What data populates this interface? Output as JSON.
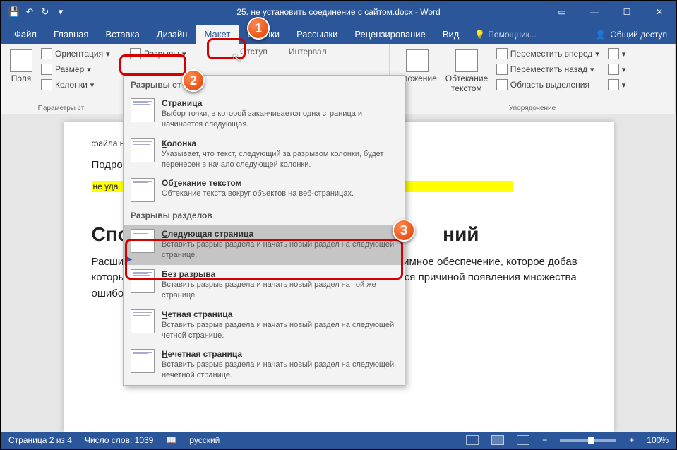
{
  "title": "25. не   установить соединение с сайтом.docx - Word",
  "qat": {
    "save": "💾",
    "undo": "↶",
    "redo": "↻"
  },
  "tabs": [
    "Файл",
    "Главная",
    "Вставка",
    "Дизайн",
    "Макет",
    "Ссылки",
    "Рассылки",
    "Рецензирование",
    "Вид"
  ],
  "activeTab": 4,
  "helper": "Помощник...",
  "share": "Общий доступ",
  "ribbon": {
    "fields": "Поля",
    "orient": "Ориентация",
    "size": "Размер",
    "columns": "Колонки",
    "breaks": "Разрывы",
    "indent": "Отступ",
    "interval": "Интервал",
    "position": "оложение",
    "wrap": "Обтекание текстом",
    "forward": "Переместить вперед",
    "backward": "Переместить назад",
    "selection": "Область выделения",
    "g1": "Параметры ст",
    "g2": "Упорядочение"
  },
  "dropdown": {
    "h1": "Разрывы ст",
    "i1": {
      "t": "Страница",
      "d": "Выбор точки, в которой заканчивается одна страница и начинается следующая."
    },
    "i2": {
      "t": "Колонка",
      "d": "Указывает, что текст, следующий за разрывом колонки, будет перенесен в начало следующей колонки."
    },
    "i3": {
      "t": "Обтекание текстом",
      "d": "Обтекание текста вокруг объектов на веб-страницах."
    },
    "h2": "Разрывы разделов",
    "i4": {
      "t": "Следующая страница",
      "d": "Вставить разрыв раздела и начать новый раздел на следующей странице."
    },
    "i5": {
      "t": "Без разрыва",
      "d": "Вставить разрыв раздела и начать новый раздел на той же странице."
    },
    "i6": {
      "t": "Четная страница",
      "d": "Вставить разрыв раздела и начать новый раздел на следующей четной странице."
    },
    "i7": {
      "t": "Нечетная страница",
      "d": "Вставить разрыв раздела и начать новый раздел на следующей нечетной странице."
    }
  },
  "doc": {
    "line1": "Подро",
    "line2": "не уда",
    "line3": "файла на компьютер.",
    "h": "Спо                                                         ний",
    "p": "Расши                                                                                               имное обеспечение, которое добав                                                                                           который такой софт может влиять на работу сети, что становится причиной появления множества ошибок. Зачастую"
  },
  "status": {
    "page": "Страница 2 из 4",
    "words": "Число слов: 1039",
    "lang": "русский",
    "zoom": "100%"
  },
  "callouts": {
    "c1": "1",
    "c2": "2",
    "c3": "3"
  }
}
